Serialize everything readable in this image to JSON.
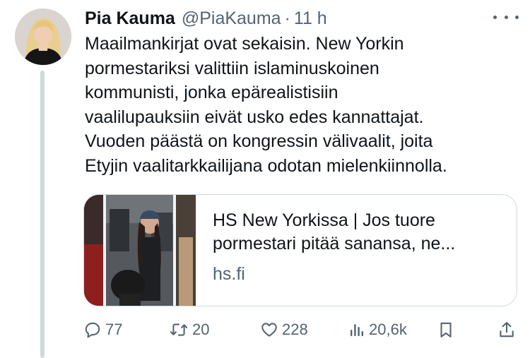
{
  "tweet": {
    "author_name": "Pia Kauma",
    "author_handle": "@PiaKauma",
    "separator": "·",
    "time": "11 h",
    "text_lines": [
      "Maailmankirjat ovat sekaisin. New Yorkin",
      "pormestariksi valittiin islaminuskoinen",
      "kommunisti, jonka epärealistisiin",
      "vaalilupauksiin eivät usko edes kannattajat.",
      "Vuoden päästä on kongressin välivaalit, joita",
      "Etyjin vaalitarkkailijana odotan mielenkiinnolla."
    ]
  },
  "link_card": {
    "title_lines": [
      "HS New Yorkissa | Jos tuore",
      "pormestari pitää sanansa, ne..."
    ],
    "domain": "hs.fi"
  },
  "actions": {
    "replies": "77",
    "reposts": "20",
    "likes": "228",
    "views": "20,6k"
  },
  "icons": {
    "more": "more-horizontal-icon",
    "reply": "reply-icon",
    "repost": "repost-icon",
    "like": "heart-icon",
    "views": "views-icon",
    "bookmark": "bookmark-icon",
    "share": "share-icon"
  },
  "colors": {
    "text_primary": "#0f1419",
    "text_secondary": "#536471",
    "border": "#cfd9de"
  }
}
